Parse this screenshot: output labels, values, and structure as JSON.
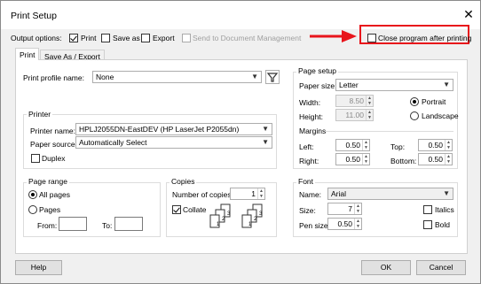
{
  "window": {
    "title": "Print Setup",
    "close_glyph": "✕"
  },
  "output_options": {
    "label": "Output options:",
    "print": {
      "label": "Print",
      "checked": true
    },
    "save_as": {
      "label": "Save as",
      "checked": false
    },
    "export": {
      "label": "Export",
      "checked": false
    },
    "send_to_dm": {
      "label": "Send to Document Management",
      "checked": false,
      "enabled": false
    },
    "close_after_printing": {
      "label": "Close program after printing",
      "checked": false
    }
  },
  "tabs": [
    {
      "label": "Print",
      "active": true
    },
    {
      "label": "Save As / Export",
      "active": false
    }
  ],
  "print_profile": {
    "label": "Print profile name:",
    "value": "None",
    "filter_icon": "filter-icon"
  },
  "printer": {
    "group_title": "Printer",
    "name_label": "Printer name:",
    "name_value": "HPLJ2055DN-EastDEV (HP LaserJet P2055dn)",
    "source_label": "Paper source:",
    "source_value": "Automatically Select",
    "duplex_label": "Duplex"
  },
  "page_range": {
    "group_title": "Page range",
    "all_pages_label": "All pages",
    "pages_label": "Pages",
    "from_label": "From:",
    "to_label": "To:"
  },
  "copies": {
    "group_title": "Copies",
    "number_label": "Number of copies:",
    "number_value": "1",
    "collate_label": "Collate",
    "collate_checked": true,
    "collate_numbers": [
      "1",
      "2",
      "3"
    ]
  },
  "page_setup": {
    "group_title": "Page setup",
    "paper_size_label": "Paper size:",
    "paper_size_value": "Letter",
    "width_label": "Width:",
    "width_value": "8.50",
    "height_label": "Height:",
    "height_value": "11.00",
    "portrait_label": "Portrait",
    "landscape_label": "Landscape",
    "orientation": "Portrait",
    "margins_title": "Margins",
    "left_label": "Left:",
    "left_value": "0.50",
    "top_label": "Top:",
    "top_value": "0.50",
    "right_label": "Right:",
    "right_value": "0.50",
    "bottom_label": "Bottom:",
    "bottom_value": "0.50"
  },
  "font": {
    "group_title": "Font",
    "name_label": "Name:",
    "name_value": "Arial",
    "size_label": "Size:",
    "size_value": "7",
    "pen_size_label": "Pen size:",
    "pen_size_value": "0.50",
    "italics_label": "Italics",
    "bold_label": "Bold"
  },
  "buttons": {
    "help": "Help",
    "ok": "OK",
    "cancel": "Cancel"
  },
  "annotation": {
    "arrow_color": "#e8141b",
    "highlight_color": "#e8141b"
  }
}
